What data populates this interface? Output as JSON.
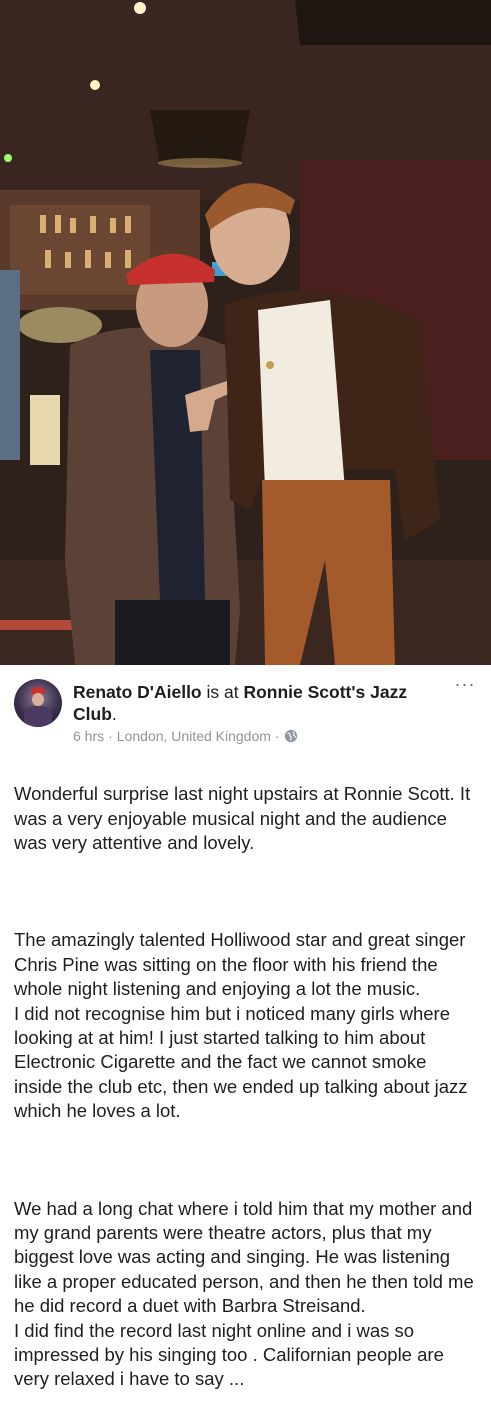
{
  "post": {
    "author": "Renato D'Aiello",
    "connector": " is at ",
    "place": "Ronnie Scott's Jazz Club",
    "period": ".",
    "time": "6 hrs",
    "separator": "·",
    "location": "London, United Kingdom",
    "separator2": "·",
    "privacy_icon": "globe-icon",
    "more_icon": "more-options-icon",
    "more_glyph": "···",
    "body_paragraph_1": "Wonderful surprise last night upstairs at Ronnie Scott. It was a very enjoyable musical night and the audience was very attentive and lovely.",
    "body_paragraph_2": "The amazingly talented Holliwood star and great singer  Chris Pine was sitting on the floor with his friend the whole night  listening and enjoying a lot the music.\nI did not recognise him but i noticed many girls where looking at at him! I just started talking to him about Electronic Cigarette and the fact we cannot smoke inside the club etc, then we ended up talking about jazz which he loves a lot.",
    "body_paragraph_3": "We had a long chat where i told him that my mother and my grand parents were theatre actors, plus that my biggest love was  acting and singing. He was listening like a proper educated person, and then he then told me he did record a duet with Barbra Streisand.\nI did find the record last night online and i was so impressed by his singing too . Californian people are very relaxed i have to say ..."
  }
}
